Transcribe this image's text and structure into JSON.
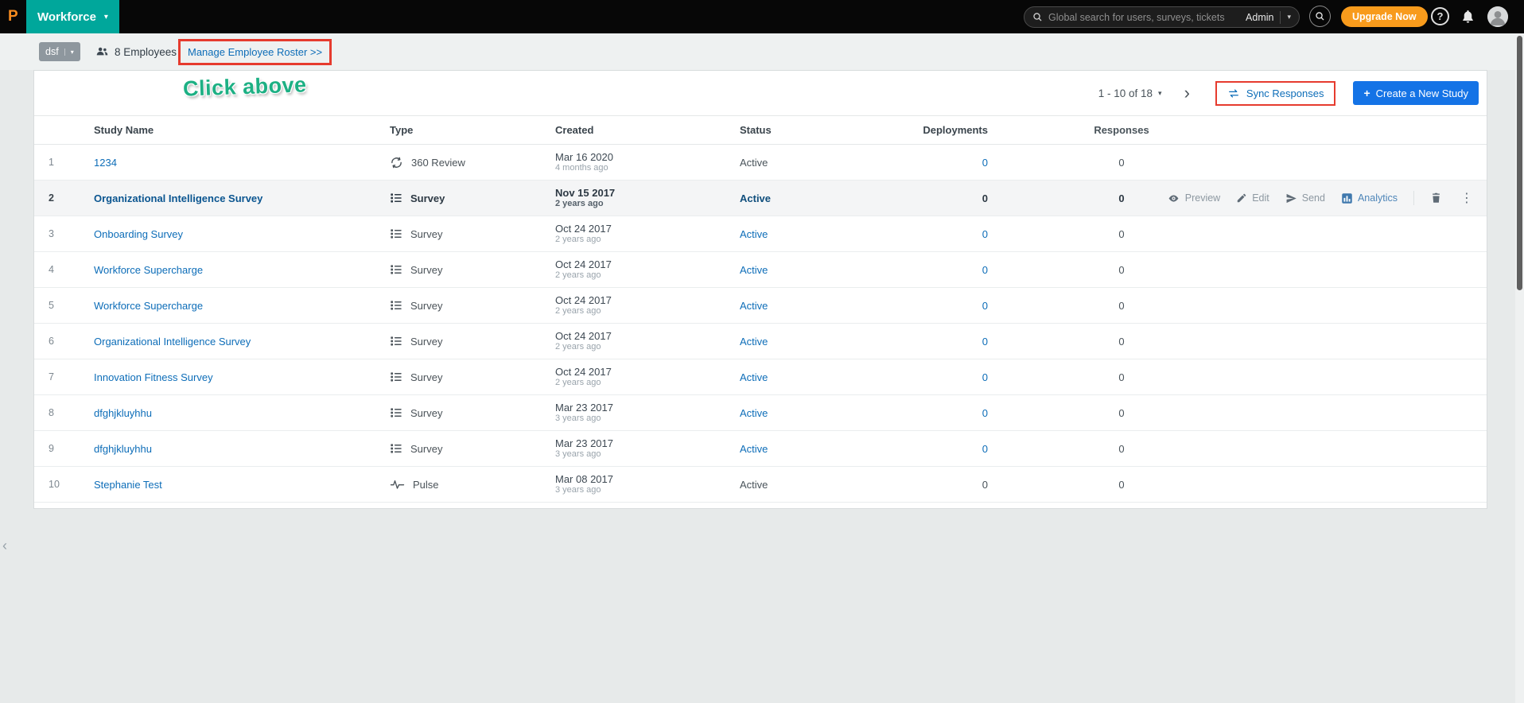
{
  "icons": {
    "logo_letter": "P",
    "caret_down": "▾",
    "next_chevron": "›",
    "collapse_chevron": "‹",
    "kebab": "⋮",
    "plus": "+",
    "help": "?"
  },
  "topnav": {
    "product_switcher": {
      "label": "Workforce"
    },
    "search": {
      "placeholder": "Global search for users, surveys, tickets",
      "scope_label": "Admin"
    },
    "upgrade_button": "Upgrade Now"
  },
  "subheader": {
    "team_dropdown_label": "dsf",
    "employee_count": "8 Employees",
    "roster_link": "Manage Employee Roster >>",
    "annotation_text": "Click above"
  },
  "toolbar": {
    "pagination_label": "1 - 10 of 18",
    "sync_button": "Sync Responses",
    "create_button": "Create a New Study"
  },
  "table": {
    "headers": {
      "study_name": "Study Name",
      "type": "Type",
      "created": "Created",
      "status": "Status",
      "deployments": "Deployments",
      "responses": "Responses"
    },
    "rows": [
      {
        "num": "1",
        "name": "1234",
        "type_icon": "360-review-icon",
        "type_label": "360 Review",
        "created": "Mar 16 2020",
        "created_ago": "4 months ago",
        "status": "Active",
        "status_style": "plain",
        "deployments": "0",
        "deployments_style": "link",
        "responses": "0",
        "highlighted": false,
        "show_actions": false
      },
      {
        "num": "2",
        "name": "Organizational Intelligence Survey",
        "type_icon": "survey-list-icon",
        "type_label": "Survey",
        "created": "Nov 15 2017",
        "created_ago": "2 years ago",
        "status": "Active",
        "status_style": "bold",
        "deployments": "0",
        "deployments_style": "bold",
        "responses": "0",
        "highlighted": true,
        "show_actions": true
      },
      {
        "num": "3",
        "name": "Onboarding Survey",
        "type_icon": "survey-list-icon",
        "type_label": "Survey",
        "created": "Oct 24 2017",
        "created_ago": "2 years ago",
        "status": "Active",
        "status_style": "link",
        "deployments": "0",
        "deployments_style": "link",
        "responses": "0",
        "highlighted": false,
        "show_actions": false
      },
      {
        "num": "4",
        "name": "Workforce Supercharge",
        "type_icon": "survey-list-icon",
        "type_label": "Survey",
        "created": "Oct 24 2017",
        "created_ago": "2 years ago",
        "status": "Active",
        "status_style": "link",
        "deployments": "0",
        "deployments_style": "link",
        "responses": "0",
        "highlighted": false,
        "show_actions": false
      },
      {
        "num": "5",
        "name": "Workforce Supercharge",
        "type_icon": "survey-list-icon",
        "type_label": "Survey",
        "created": "Oct 24 2017",
        "created_ago": "2 years ago",
        "status": "Active",
        "status_style": "link",
        "deployments": "0",
        "deployments_style": "link",
        "responses": "0",
        "highlighted": false,
        "show_actions": false
      },
      {
        "num": "6",
        "name": "Organizational Intelligence Survey",
        "type_icon": "survey-list-icon",
        "type_label": "Survey",
        "created": "Oct 24 2017",
        "created_ago": "2 years ago",
        "status": "Active",
        "status_style": "link",
        "deployments": "0",
        "deployments_style": "link",
        "responses": "0",
        "highlighted": false,
        "show_actions": false
      },
      {
        "num": "7",
        "name": "Innovation Fitness Survey",
        "type_icon": "survey-list-icon",
        "type_label": "Survey",
        "created": "Oct 24 2017",
        "created_ago": "2 years ago",
        "status": "Active",
        "status_style": "link",
        "deployments": "0",
        "deployments_style": "link",
        "responses": "0",
        "highlighted": false,
        "show_actions": false
      },
      {
        "num": "8",
        "name": "dfghjkluyhhu",
        "type_icon": "survey-list-icon",
        "type_label": "Survey",
        "created": "Mar 23 2017",
        "created_ago": "3 years ago",
        "status": "Active",
        "status_style": "link",
        "deployments": "0",
        "deployments_style": "link",
        "responses": "0",
        "highlighted": false,
        "show_actions": false
      },
      {
        "num": "9",
        "name": "dfghjkluyhhu",
        "type_icon": "survey-list-icon",
        "type_label": "Survey",
        "created": "Mar 23 2017",
        "created_ago": "3 years ago",
        "status": "Active",
        "status_style": "link",
        "deployments": "0",
        "deployments_style": "link",
        "responses": "0",
        "highlighted": false,
        "show_actions": false
      },
      {
        "num": "10",
        "name": "Stephanie Test",
        "type_icon": "pulse-icon",
        "type_label": "Pulse",
        "created": "Mar 08 2017",
        "created_ago": "3 years ago",
        "status": "Active",
        "status_style": "plain",
        "deployments": "0",
        "deployments_style": "plain",
        "responses": "0",
        "highlighted": false,
        "show_actions": false
      }
    ]
  },
  "row_actions": {
    "preview": "Preview",
    "edit": "Edit",
    "send": "Send",
    "analytics": "Analytics"
  },
  "colors": {
    "accent_teal": "#00a79b",
    "link_blue": "#0d6db8",
    "upgrade_orange": "#f89b1c",
    "create_blue": "#1473e6",
    "annotation_red": "#e63b2e",
    "annotation_green": "#1db084"
  }
}
